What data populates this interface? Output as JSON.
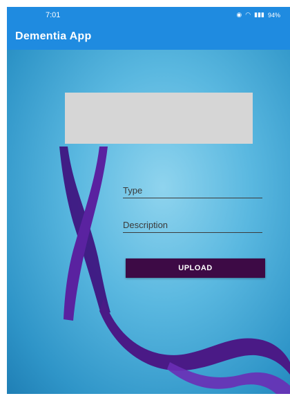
{
  "status_bar": {
    "time": "7:01",
    "battery": "94%",
    "icons": [
      "eye-icon",
      "wifi-icon",
      "signal-icon"
    ]
  },
  "app_bar": {
    "title": "Dementia App"
  },
  "form": {
    "type_placeholder": "Type",
    "description_placeholder": "Description",
    "upload_label": "UPLOAD"
  },
  "colors": {
    "app_bar": "#1f8be0",
    "upload_button": "#3d0a45",
    "ribbon": "#4a1a86",
    "image_placeholder": "#d6d6d6"
  }
}
